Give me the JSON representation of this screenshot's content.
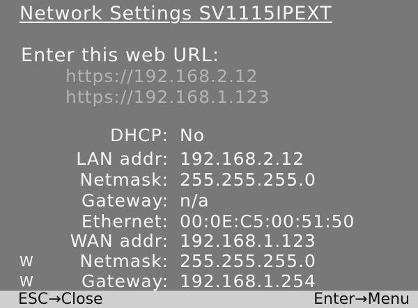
{
  "title": "Network Settings SV1115IPEXT",
  "url_prompt": "Enter this web URL:",
  "urls": [
    "https://192.168.2.12",
    "https://192.168.1.123"
  ],
  "settings": [
    {
      "prefix": "",
      "label": "DHCP:",
      "value": "No"
    },
    {
      "prefix": "",
      "label": "LAN addr:",
      "value": "192.168.2.12"
    },
    {
      "prefix": "",
      "label": "Netmask:",
      "value": "255.255.255.0"
    },
    {
      "prefix": "",
      "label": "Gateway:",
      "value": "n/a"
    },
    {
      "prefix": "",
      "label": "Ethernet:",
      "value": "00:0E:C5:00:51:50"
    },
    {
      "prefix": "",
      "label": "WAN addr:",
      "value": "192.168.1.123"
    },
    {
      "prefix": "W",
      "label": "Netmask:",
      "value": "255.255.255.0"
    },
    {
      "prefix": "W",
      "label": "Gateway:",
      "value": "192.168.1.254"
    }
  ],
  "footer": {
    "left": "ESC→Close",
    "right": "Enter→Menu"
  },
  "colors": {
    "background": "#787878",
    "text": "#f4f4f4",
    "url_text": "#b4b4b4",
    "footer_bar": "#cfcfcf",
    "footer_text": "#111111"
  }
}
